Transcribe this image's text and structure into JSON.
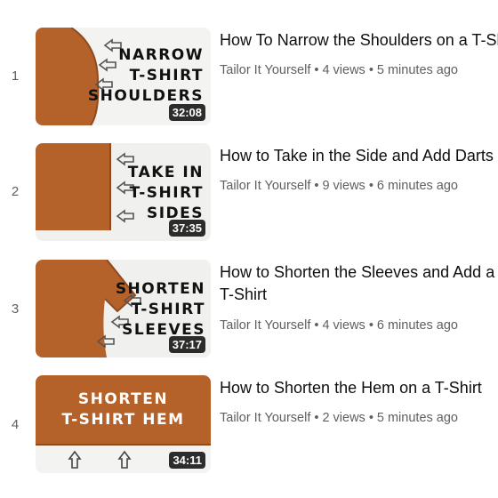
{
  "playlist": {
    "items": [
      {
        "index": "1",
        "thumb_text": [
          "NARROW",
          "T-SHIRT",
          "SHOULDERS"
        ],
        "duration": "32:08",
        "title": "How To Narrow the Shoulders on a T-Shirt",
        "channel": "Tailor It Yourself",
        "views": "4 views",
        "age": "5 minutes ago"
      },
      {
        "index": "2",
        "thumb_text": [
          "TAKE IN",
          "T-SHIRT",
          "SIDES"
        ],
        "duration": "37:35",
        "title": "How to Take in the Side and Add Darts",
        "channel": "Tailor It Yourself",
        "views": "9 views",
        "age": "6 minutes ago"
      },
      {
        "index": "3",
        "thumb_text": [
          "SHORTEN",
          "T-SHIRT",
          "SLEEVES"
        ],
        "duration": "37:17",
        "title": "How to Shorten the Sleeves and Add a T-Shirt",
        "channel": "Tailor It Yourself",
        "views": "4 views",
        "age": "6 minutes ago"
      },
      {
        "index": "4",
        "thumb_text": [
          "SHORTEN",
          "T-SHIRT HEM"
        ],
        "duration": "34:11",
        "title": "How to Shorten the Hem on a T-Shirt",
        "channel": "Tailor It Yourself",
        "views": "2 views",
        "age": "5 minutes ago"
      }
    ],
    "separator": "•"
  },
  "colors": {
    "fabric": "#b5612a",
    "fabric_dark": "#8f4a1f",
    "meta_text": "#606060",
    "title_text": "#0f0f0f"
  },
  "icons": {
    "arrow": "outline-arrow-icon"
  }
}
